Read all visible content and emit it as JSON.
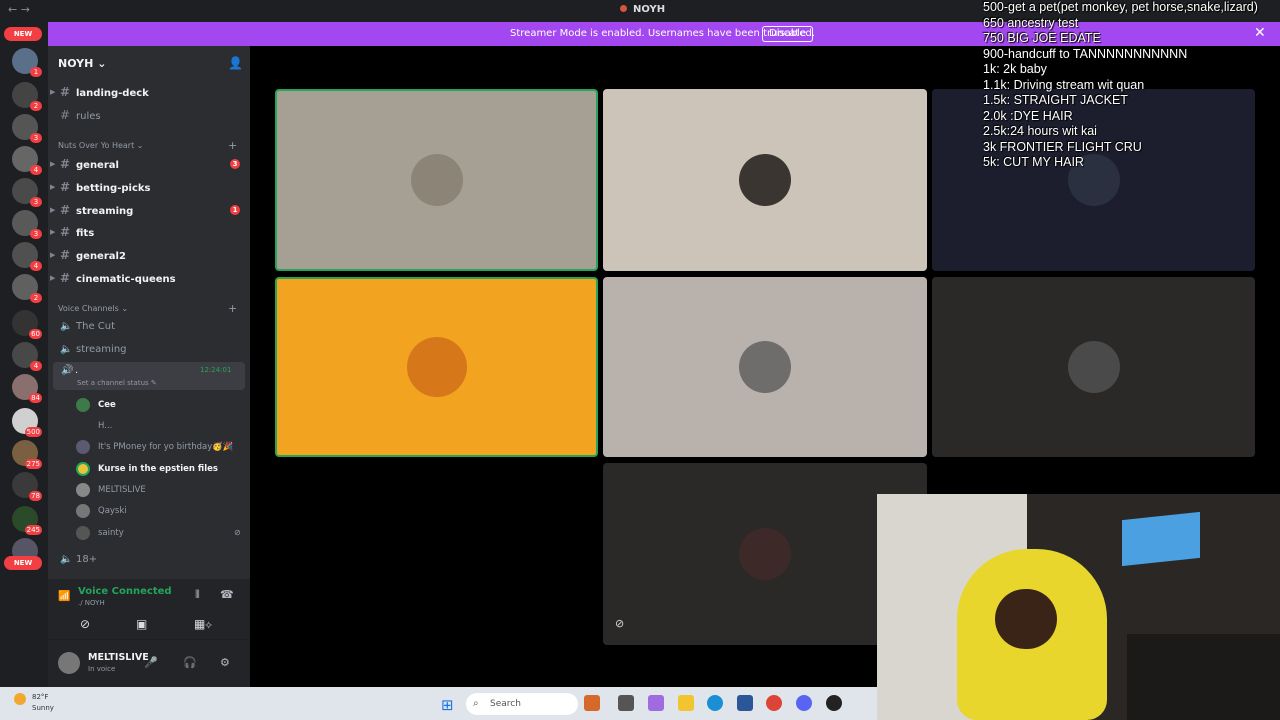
{
  "window": {
    "nav": "← →",
    "title": "NOYH"
  },
  "banner": {
    "message": "Streamer Mode is enabled. Usernames have been truncated.",
    "button": "Disable",
    "close": "✕"
  },
  "rail": {
    "top_pill": "NEW",
    "bottom_pill": "NEW",
    "badges": [
      "1",
      "2",
      "3",
      "4",
      "3",
      "3",
      "4",
      "2",
      "60",
      "4",
      "84",
      "500",
      "275",
      "78",
      "245"
    ]
  },
  "sidebar": {
    "server_name": "NOYH",
    "top_channels": [
      "landing-deck",
      "rules"
    ],
    "category1": "Nuts Over Yo Heart",
    "channels": [
      {
        "name": "general",
        "mention": "3"
      },
      {
        "name": "betting-picks",
        "mention": ""
      },
      {
        "name": "streaming",
        "mention": "1"
      },
      {
        "name": "fits",
        "mention": ""
      },
      {
        "name": "general2",
        "mention": ""
      },
      {
        "name": "cinematic-queens",
        "mention": ""
      }
    ],
    "category2": "Voice Channels",
    "voice_channels": [
      "The Cut",
      "streaming"
    ],
    "active_voice": {
      "name": ".",
      "timer": "12:24:01",
      "status": "Set a channel status"
    },
    "voice_users": [
      "Cee",
      "H...",
      "It's PMoney for yo birthday🥳🎉",
      "Kurse in the epstien files",
      "MELTISLIVE",
      "Qayski",
      "sainty"
    ],
    "extra_voice": "18+"
  },
  "voice_panel": {
    "title": "Voice Connected",
    "sub": "./ NOYH"
  },
  "user_panel": {
    "name": "MELTISLIVE",
    "status": "In voice"
  },
  "overlay_goals": [
    "500-get a pet(pet monkey, pet horse,snake,lizard)",
    "650 ancestry test",
    "750 BIG JOE EDATE",
    "900-handcuff to TANNNNNNNNNNN",
    "1k: 2k baby",
    "1.1k: Driving stream wit quan",
    "1.5k: STRAIGHT JACKET",
    "2.0k :DYE HAIR",
    "2.5k:24 hours wit kai",
    "3k FRONTIER FLIGHT CRU",
    "5k: CUT MY HAIR"
  ],
  "taskbar": {
    "temp": "82°F",
    "condition": "Sunny",
    "search": "Search"
  },
  "colors": {
    "accent": "#a348f0",
    "green": "#23a55a",
    "red": "#f23f43",
    "orange_tile": "#f2a31f"
  }
}
